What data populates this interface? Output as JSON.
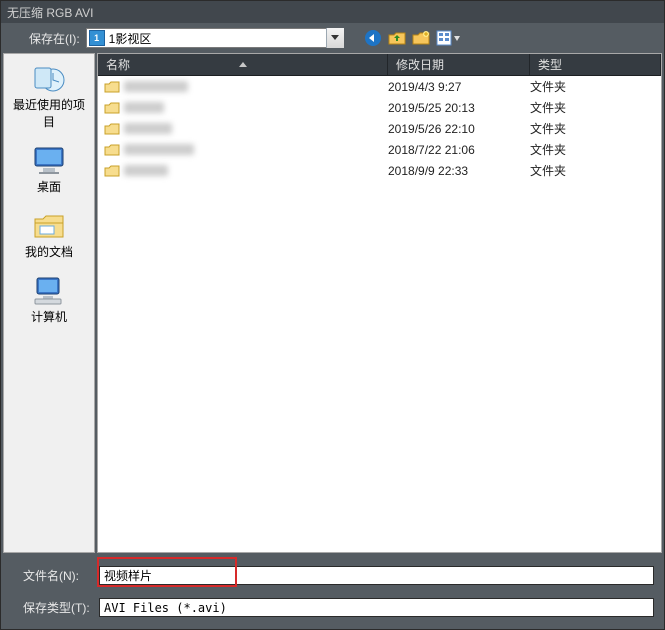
{
  "title": "无压缩 RGB AVI",
  "savein": {
    "label": "保存在(I):",
    "value": "1影视区"
  },
  "toolbar": {
    "back": "back-icon",
    "up": "up-icon",
    "newfolder": "newfolder-icon",
    "views": "views-icon"
  },
  "places": [
    {
      "key": "recent",
      "label": "最近使用的项目"
    },
    {
      "key": "desktop",
      "label": "桌面"
    },
    {
      "key": "docs",
      "label": "我的文档"
    },
    {
      "key": "computer",
      "label": "计算机"
    }
  ],
  "columns": {
    "name": "名称",
    "date": "修改日期",
    "type": "类型"
  },
  "rows": [
    {
      "date": "2019/4/3 9:27",
      "type": "文件夹"
    },
    {
      "date": "2019/5/25 20:13",
      "type": "文件夹"
    },
    {
      "date": "2019/5/26 22:10",
      "type": "文件夹"
    },
    {
      "date": "2018/7/22 21:06",
      "type": "文件夹"
    },
    {
      "date": "2018/9/9 22:33",
      "type": "文件夹"
    }
  ],
  "filename": {
    "label": "文件名(N):",
    "value": "视频样片"
  },
  "filetype": {
    "label": "保存类型(T):",
    "value": "AVI Files (*.avi)"
  }
}
